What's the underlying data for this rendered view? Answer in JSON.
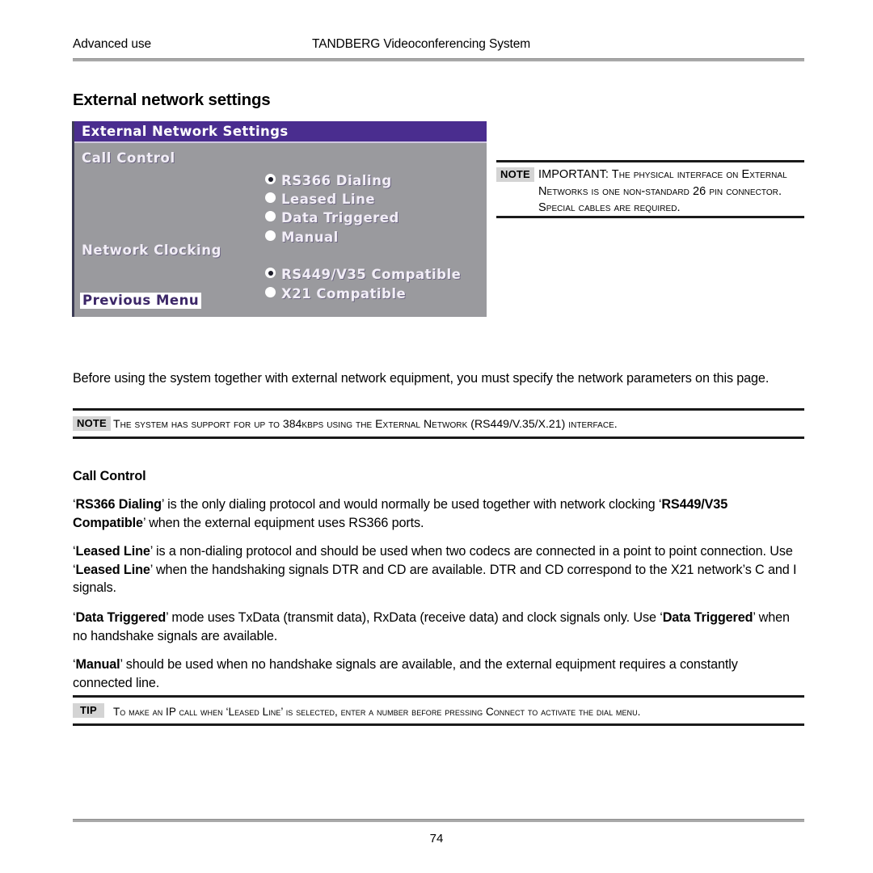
{
  "header": {
    "left": "Advanced use",
    "center": "TANDBERG Videoconferencing System"
  },
  "page_title": "External network settings",
  "osd_menu": {
    "title": "External Network Settings",
    "groups": [
      {
        "label": "Call Control",
        "options": [
          {
            "label": "RS366 Dialing",
            "selected": true
          },
          {
            "label": "Leased Line",
            "selected": false
          },
          {
            "label": "Data Triggered",
            "selected": false
          },
          {
            "label": "Manual",
            "selected": false
          }
        ]
      },
      {
        "label": "Network Clocking",
        "options": [
          {
            "label": "RS449/V35 Compatible",
            "selected": true
          },
          {
            "label": "X21 Compatible",
            "selected": false
          }
        ]
      }
    ],
    "previous_menu": "Previous Menu",
    "colors": {
      "titlebar": "#4a2d8f",
      "body": "#9a9a9e",
      "text": "#f2eef7",
      "highlight_bg": "#ffffff",
      "highlight_text": "#3c2768"
    }
  },
  "note_side": {
    "tag": "NOTE",
    "text": "IMPORTANT: The physical interface on External Networks is one non-standard 26 pin connector. Special cables are required."
  },
  "intro_paragraph": "Before using the system together with external network equipment, you must specify the network parameters on this page.",
  "note_wide": {
    "tag": "NOTE",
    "text": "The system has support for up to 384kbps using the External Network (RS449/V.35/X.21) interface."
  },
  "section": {
    "heading": "Call Control",
    "paragraphs": [
      {
        "parts": [
          {
            "text": "‘",
            "bold": false
          },
          {
            "text": "RS366 Dialing",
            "bold": true
          },
          {
            "text": "’ is the only dialing protocol and would normally be used together with network clocking ‘",
            "bold": false
          },
          {
            "text": "RS449/V35 Compatible",
            "bold": true
          },
          {
            "text": "’ when the external equipment uses RS366 ports.",
            "bold": false
          }
        ]
      },
      {
        "parts": [
          {
            "text": "‘",
            "bold": false
          },
          {
            "text": "Leased Line",
            "bold": true
          },
          {
            "text": "’ is a non-dialing protocol and should be used when two codecs are connected in a point to point connection. Use ‘",
            "bold": false
          },
          {
            "text": "Leased Line",
            "bold": true
          },
          {
            "text": "’ when the handshaking signals DTR and CD are available. DTR and CD correspond to the X21 network’s C and I signals.",
            "bold": false
          }
        ]
      },
      {
        "parts": [
          {
            "text": "‘",
            "bold": false
          },
          {
            "text": "Data Triggered",
            "bold": true
          },
          {
            "text": "’ mode uses TxData (transmit data), RxData (receive data) and clock signals only. Use ‘",
            "bold": false
          },
          {
            "text": "Data Triggered",
            "bold": true
          },
          {
            "text": "’ when no handshake signals are available.",
            "bold": false
          }
        ]
      },
      {
        "parts": [
          {
            "text": "‘",
            "bold": false
          },
          {
            "text": "Manual",
            "bold": true
          },
          {
            "text": "’ should be used when no handshake signals are available, and the external equipment requires a constantly connected line.",
            "bold": false
          }
        ]
      }
    ]
  },
  "tip": {
    "tag": "TIP",
    "text": "To make an IP call when ‘Leased Line’ is selected, enter a number before pressing Connect to activate the dial menu."
  },
  "page_number": "74"
}
